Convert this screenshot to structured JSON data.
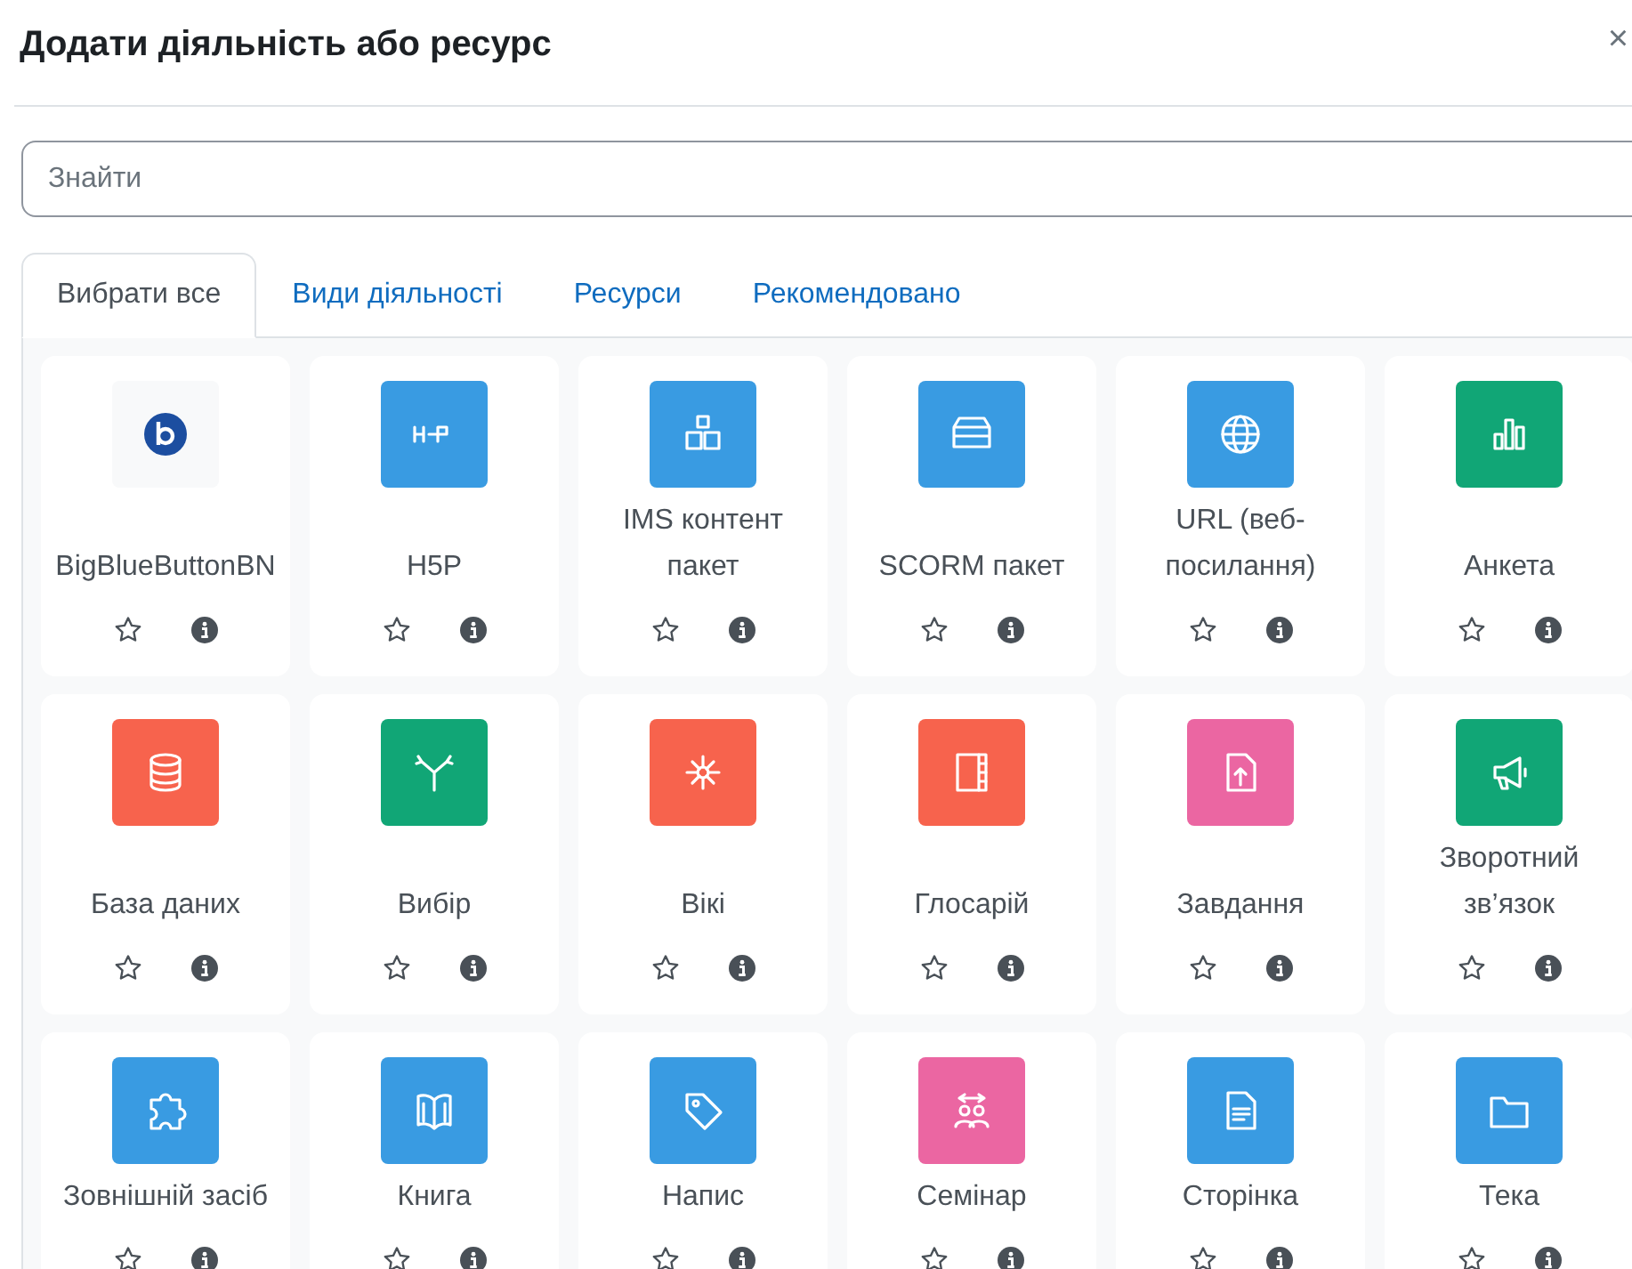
{
  "dialog": {
    "title": "Додати діяльність або ресурс",
    "close": "×"
  },
  "search": {
    "placeholder": "Знайти"
  },
  "tabs": [
    {
      "label": "Вибрати все",
      "selected": true
    },
    {
      "label": "Види діяльності",
      "selected": false
    },
    {
      "label": "Ресурси",
      "selected": false
    },
    {
      "label": "Рекомендовано",
      "selected": false
    }
  ],
  "items": [
    {
      "label": "BigBlueButtonBN",
      "color": "#f8f9fa"
    },
    {
      "label": "H5P",
      "color": "#399be2"
    },
    {
      "label": "IMS контент пакет",
      "color": "#399be2"
    },
    {
      "label": "SCORM пакет",
      "color": "#399be2"
    },
    {
      "label": "URL (веб-посилання)",
      "color": "#399be2"
    },
    {
      "label": "Анкета",
      "color": "#11a676"
    },
    {
      "label": "База даних",
      "color": "#f7634d"
    },
    {
      "label": "Вибір",
      "color": "#11a676"
    },
    {
      "label": "Вікі",
      "color": "#f7634d"
    },
    {
      "label": "Глосарій",
      "color": "#f7634d"
    },
    {
      "label": "Завдання",
      "color": "#eb66a2"
    },
    {
      "label": "Зворотний зв’язок",
      "color": "#11a676"
    },
    {
      "label": "Зовнішній засіб",
      "color": "#399be2"
    },
    {
      "label": "Книга",
      "color": "#399be2"
    },
    {
      "label": "Напис",
      "color": "#399be2"
    },
    {
      "label": "Семінар",
      "color": "#eb66a2"
    },
    {
      "label": "Сторінка",
      "color": "#399be2"
    },
    {
      "label": "Тека",
      "color": "#399be2"
    }
  ]
}
